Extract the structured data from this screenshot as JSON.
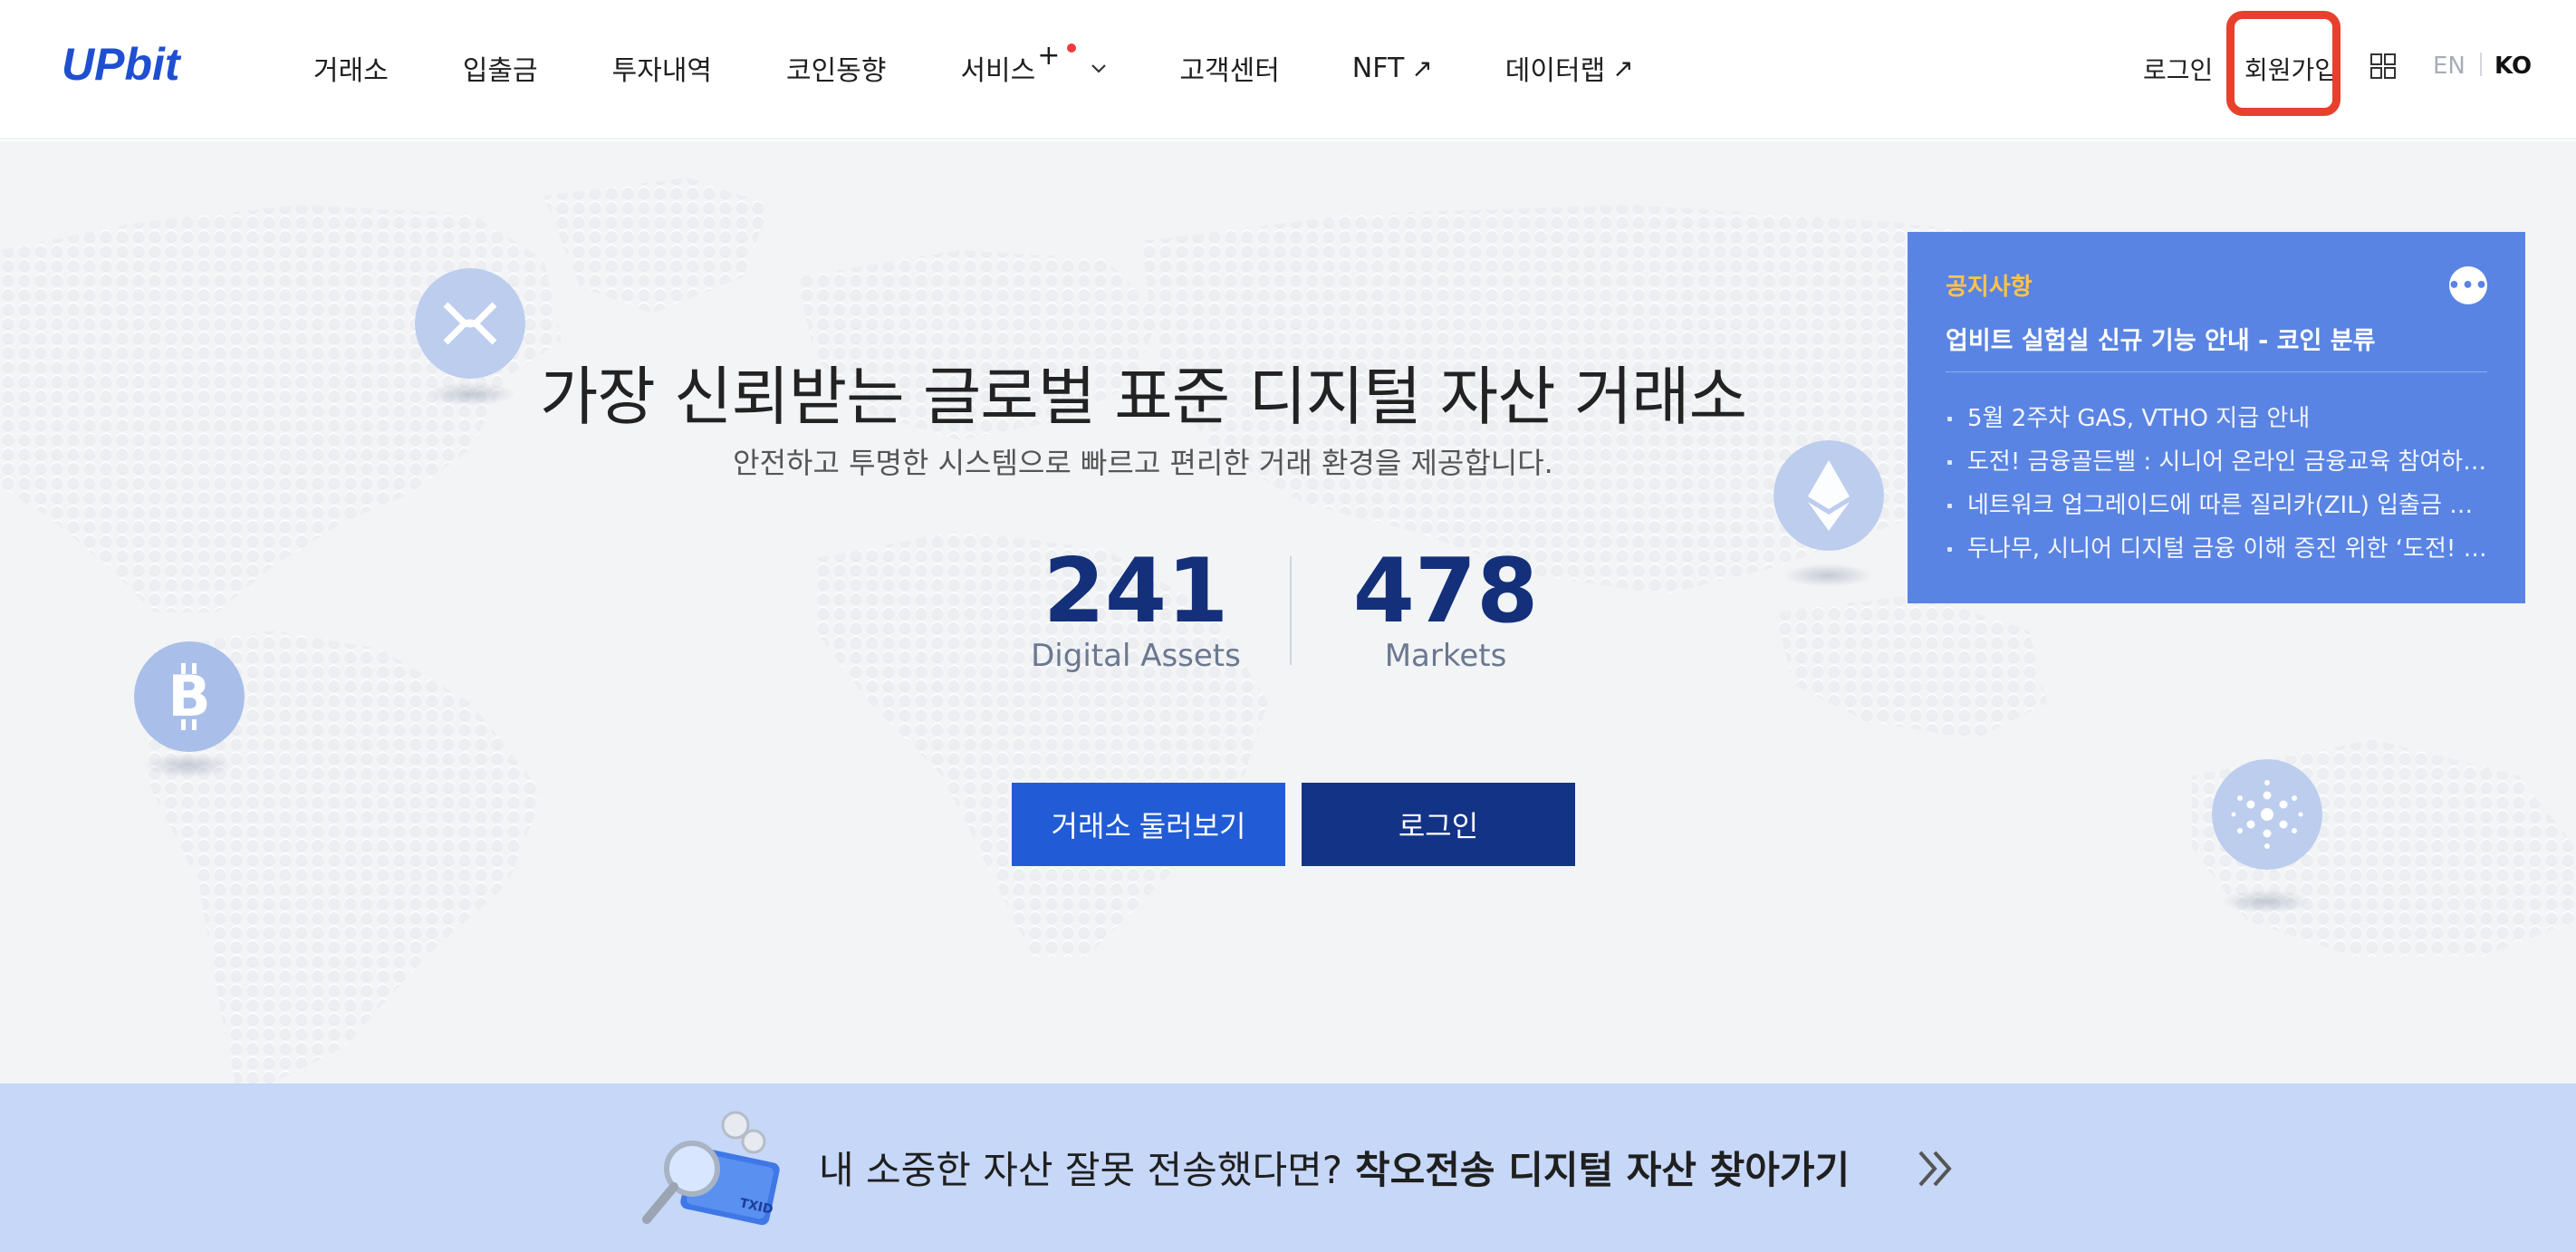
{
  "brand": {
    "logo_text": "UPbit"
  },
  "nav": {
    "items": [
      {
        "label": "거래소"
      },
      {
        "label": "입출금"
      },
      {
        "label": "투자내역"
      },
      {
        "label": "코인동향"
      },
      {
        "label": "서비스",
        "suffix": "+"
      },
      {
        "label": "고객센터"
      },
      {
        "label": "NFT",
        "suffix": "↗"
      },
      {
        "label": "데이터랩",
        "suffix": "↗"
      }
    ]
  },
  "header_right": {
    "login": "로그인",
    "signup": "회원가입",
    "lang_en": "EN",
    "lang_ko": "KO"
  },
  "hero": {
    "title": "가장 신뢰받는 글로벌 표준 디지털 자산 거래소",
    "subtitle": "안전하고 투명한 시스템으로 빠르고 편리한 거래 환경을 제공합니다.",
    "stats": [
      {
        "value": "241",
        "label": "Digital Assets"
      },
      {
        "value": "478",
        "label": "Markets"
      }
    ],
    "buttons": {
      "explore": "거래소 둘러보기",
      "login": "로그인"
    }
  },
  "notice": {
    "heading": "공지사항",
    "top_item": "업비트 실험실 신규 기능 안내 - 코인 분류",
    "items": [
      "5월 2주차 GAS, VTHO 지급 안내",
      "도전! 금융골든벨 : 시니어 온라인 금융교육 참여하고 ...",
      "네트워크 업그레이드에 따른 질리카(ZIL) 입출금 일시...",
      "두나무, 시니어 디지털 금융 이해 증진 위한 ‘도전! 금..."
    ]
  },
  "banner": {
    "text_normal": "내 소중한 자산 잘못 전송했다면?",
    "text_bold": "착오전송 디지털 자산 찾아가기",
    "illustration_label": "TXID"
  },
  "colors": {
    "brand_blue": "#1f4fd1",
    "primary_button": "#215bd6",
    "dark_button": "#133386",
    "stat_number": "#14307a",
    "notice_bg": "#5a84e3",
    "notice_heading": "#ffc34d",
    "banner_bg": "#c6d7f7",
    "highlight": "#e7402d"
  },
  "icons": {
    "grid": "grid-icon",
    "chevron": "chevron-down-icon",
    "more": "more-dots-icon",
    "banner_arrow": "double-chevron-right-icon",
    "coins": [
      "xrp-coin-icon",
      "ethereum-coin-icon",
      "bitcoin-coin-icon",
      "cardano-coin-icon"
    ]
  }
}
